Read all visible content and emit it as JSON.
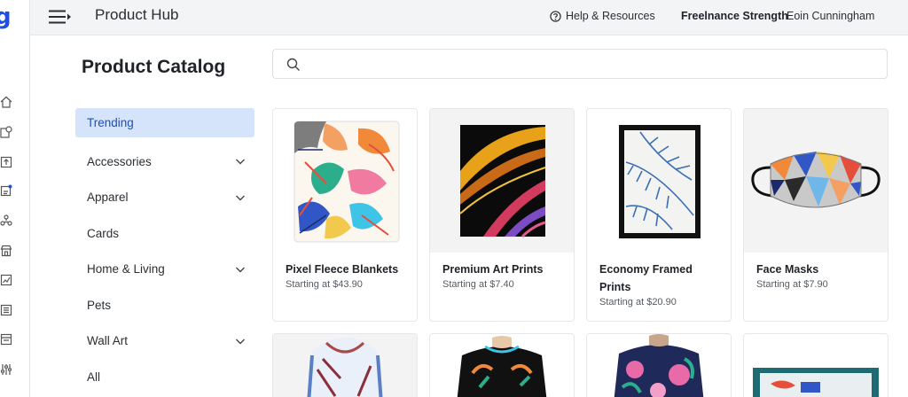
{
  "rail": {
    "logo": "g",
    "icons": [
      "home-icon",
      "catalog-icon",
      "upload-icon",
      "orders-icon",
      "integrations-icon",
      "store-icon",
      "analytics-icon",
      "billing-icon",
      "reports-icon",
      "settings-sliders-icon"
    ]
  },
  "header": {
    "title": "Product Hub",
    "help": "Help & Resources",
    "store_name": "Freelnance Strength",
    "user_name": "Eoin Cunningham"
  },
  "page": {
    "title": "Product Catalog"
  },
  "search": {
    "value": "",
    "placeholder": ""
  },
  "categories": [
    {
      "label": "Trending",
      "active": true,
      "expandable": false
    },
    {
      "label": "Accessories",
      "active": false,
      "expandable": true
    },
    {
      "label": "Apparel",
      "active": false,
      "expandable": true
    },
    {
      "label": "Cards",
      "active": false,
      "expandable": false
    },
    {
      "label": "Home & Living",
      "active": false,
      "expandable": true
    },
    {
      "label": "Pets",
      "active": false,
      "expandable": false
    },
    {
      "label": "Wall Art",
      "active": false,
      "expandable": true
    },
    {
      "label": "All",
      "active": false,
      "expandable": false
    }
  ],
  "products": [
    {
      "name": "Pixel Fleece Blankets",
      "price": "Starting at $43.90"
    },
    {
      "name": "Premium Art Prints",
      "price": "Starting at $7.40"
    },
    {
      "name": "Economy Framed Prints",
      "price": "Starting at $20.90"
    },
    {
      "name": "Face Masks",
      "price": "Starting at $7.90"
    }
  ],
  "colors": {
    "brand": "#1f4fe0",
    "active_bg": "#d6e4fb",
    "topbar_bg": "#f3f4f6"
  }
}
